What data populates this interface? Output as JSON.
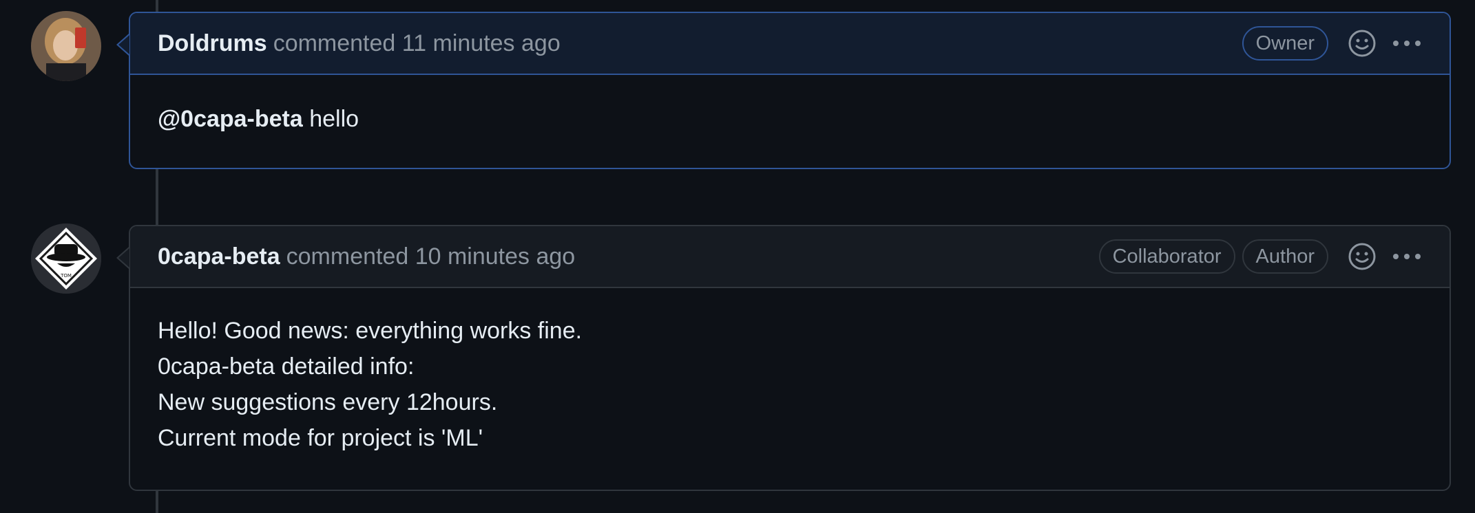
{
  "comments": [
    {
      "author": "Doldrums",
      "meta": "commented 11 minutes ago",
      "badges": [
        "Owner"
      ],
      "mention": "@0capa-beta",
      "text": " hello"
    },
    {
      "author": "0capa-beta",
      "meta": "commented 10 minutes ago",
      "badges": [
        "Collaborator",
        "Author"
      ],
      "lines": [
        "Hello! Good news: everything works fine.",
        "0capa-beta detailed info:",
        "New suggestions every 12hours.",
        "Current mode for project is 'ML'"
      ]
    }
  ],
  "avatar2_label": "TOM",
  "icons": {
    "reaction": "smiley-icon",
    "more": "kebab-horizontal-icon"
  },
  "colors": {
    "owner_border": "#2f5597",
    "bg": "#0d1117",
    "muted": "#8d96a0"
  }
}
